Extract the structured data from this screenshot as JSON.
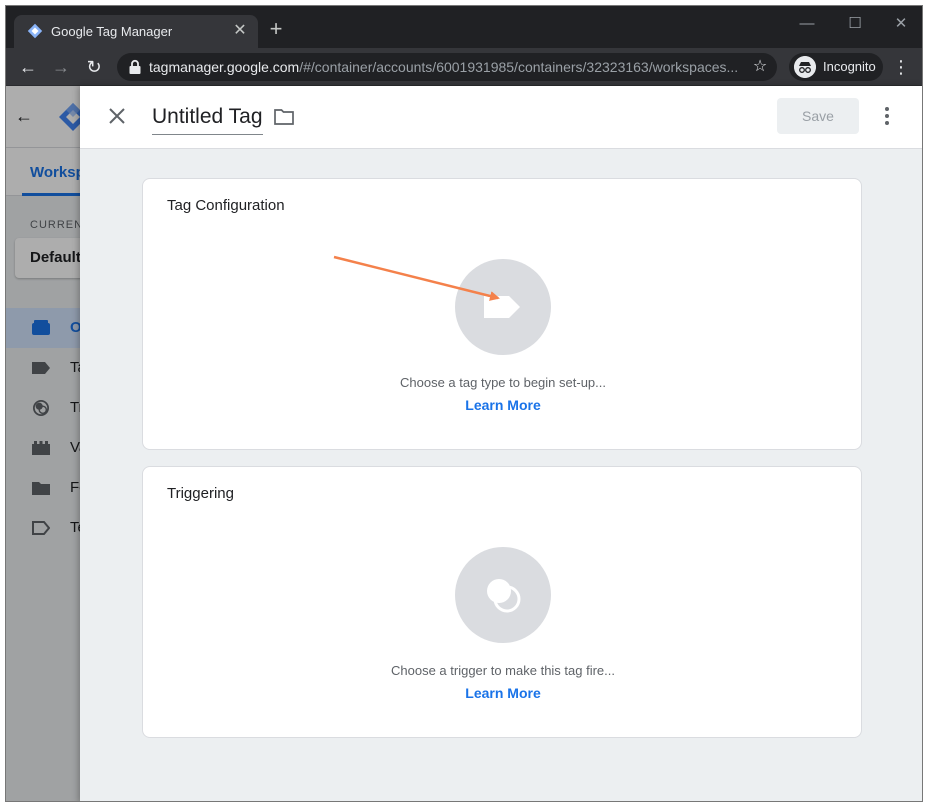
{
  "browser": {
    "tab_title": "Google Tag Manager",
    "tab_close": "✕",
    "new_tab": "+",
    "url_host": "tagmanager.google.com",
    "url_path": "/#/container/accounts/6001931985/containers/32323163/workspaces...",
    "incognito_label": "Incognito",
    "window_controls": {
      "minimize": "—",
      "maximize": "☐",
      "close": "✕"
    }
  },
  "background_page": {
    "tab_workspace": "Worksp",
    "current_label": "CURRENT",
    "workspace_select": "Default",
    "nav_items": [
      {
        "label": "O",
        "icon": "overview-icon",
        "active": true
      },
      {
        "label": "Ta",
        "icon": "tags-icon",
        "active": false
      },
      {
        "label": "Tr",
        "icon": "triggers-icon",
        "active": false
      },
      {
        "label": "Va",
        "icon": "variables-icon",
        "active": false
      },
      {
        "label": "Fo",
        "icon": "folders-icon",
        "active": false
      },
      {
        "label": "Te",
        "icon": "templates-icon",
        "active": false
      }
    ]
  },
  "editor": {
    "title": "Untitled Tag",
    "save_label": "Save",
    "tag_config": {
      "title": "Tag Configuration",
      "hint": "Choose a tag type to begin set-up...",
      "link": "Learn More",
      "icon": "tag-icon"
    },
    "triggering": {
      "title": "Triggering",
      "hint": "Choose a trigger to make this tag fire...",
      "link": "Learn More",
      "icon": "trigger-icon"
    }
  },
  "colors": {
    "accent": "#1a73e8",
    "annotation_arrow": "#f4814b"
  }
}
